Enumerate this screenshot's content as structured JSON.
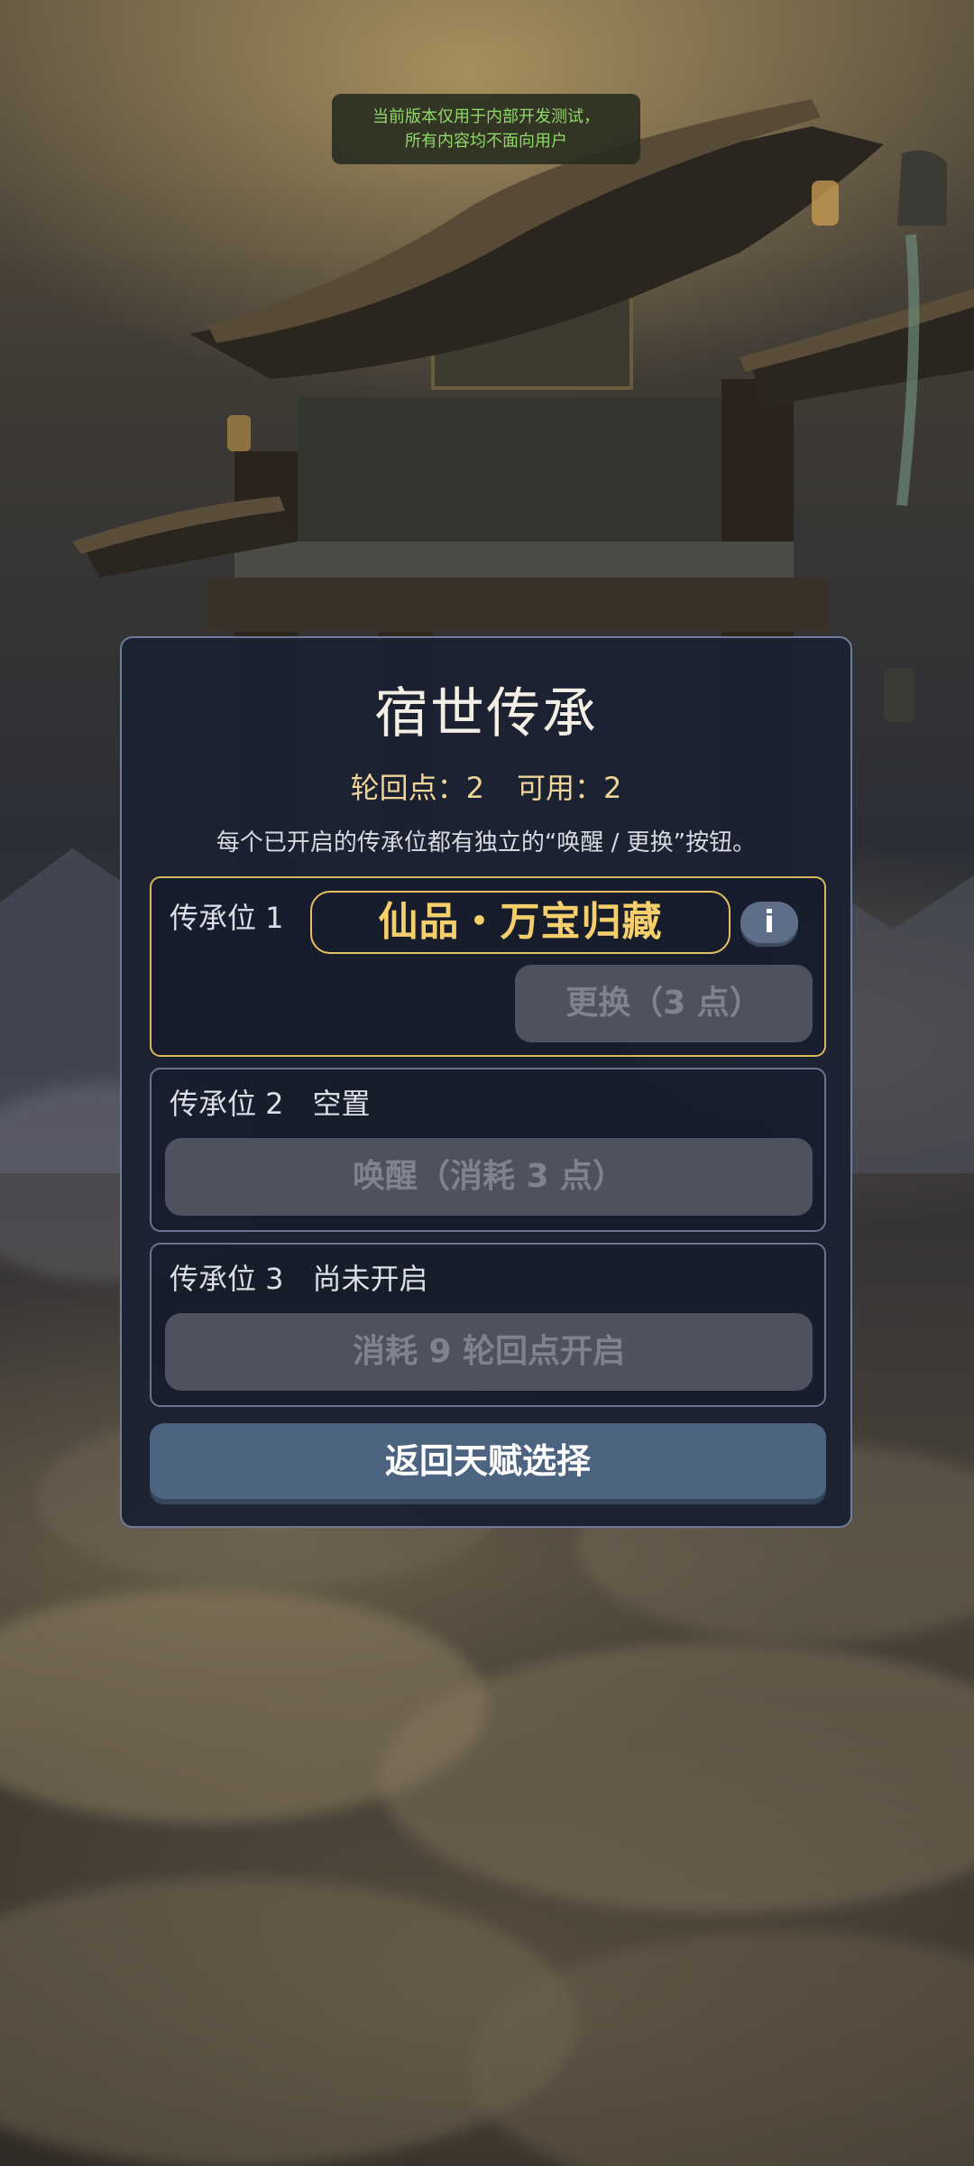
{
  "banner": {
    "line1": "当前版本仅用于内部开发测试，",
    "line2": "所有内容均不面向用户"
  },
  "dialog": {
    "title": "宿世传承",
    "points_label": "轮回点：2",
    "available_label": "可用：2",
    "hint": "每个已开启的传承位都有独立的“唤醒 / 更换”按钮。",
    "slots": [
      {
        "label": "传承位 1",
        "talent_name": "仙品・万宝归藏",
        "info_icon": "i",
        "action": "更换（3 点）"
      },
      {
        "label": "传承位 2　空置",
        "action": "唤醒（消耗 3 点）"
      },
      {
        "label": "传承位 3　尚未开启",
        "action": "消耗 9 轮回点开启"
      }
    ],
    "back_button": "返回天赋选择"
  },
  "colors": {
    "panel": "#1b2131",
    "gold": "#e6c064",
    "button_disabled": "#4f525e",
    "button_primary": "#4d6481",
    "banner_text": "#8fd96a"
  }
}
